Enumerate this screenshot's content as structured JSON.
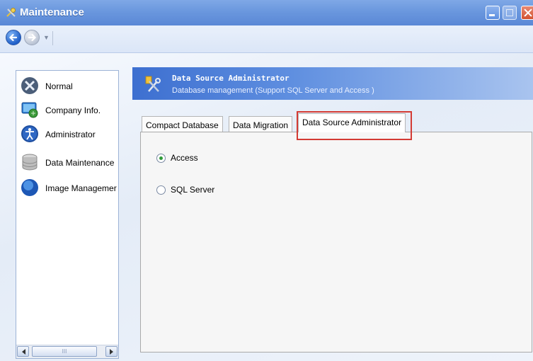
{
  "window": {
    "title": "Maintenance"
  },
  "sidebar": {
    "items": [
      {
        "label": "Normal",
        "icon": "tools-icon"
      },
      {
        "label": "Company Info.",
        "icon": "computer-icon"
      },
      {
        "label": "Administrator",
        "icon": "accessibility-icon"
      },
      {
        "label": "Data Maintenance",
        "icon": "database-icon"
      },
      {
        "label": "Image Managemer",
        "icon": "globe-icon"
      }
    ],
    "scrollbar_thumb": "III"
  },
  "header": {
    "title": "Data Source Administrator",
    "subtitle": "Database management (Support  SQL Server  and Access )"
  },
  "tabs": [
    {
      "label": "Compact Database"
    },
    {
      "label": "Data Migration"
    },
    {
      "label": "Data Source Administrator"
    }
  ],
  "active_tab": "Data Source Administrator",
  "options": [
    {
      "label": "Access",
      "checked": true
    },
    {
      "label": "SQL Server",
      "checked": false
    }
  ],
  "colors": {
    "title_bar": "#6a97de",
    "banner": "#3d6fd0",
    "highlight": "#d43b34",
    "radio_check": "#2f9a39"
  }
}
